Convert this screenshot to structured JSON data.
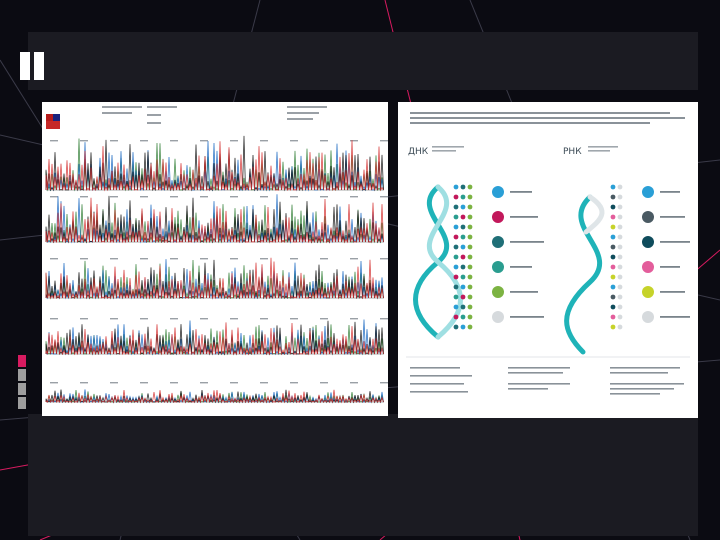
{
  "slide": {
    "dna_heading": "ДНК",
    "rna_heading": "РНК"
  },
  "colors": {
    "slide_background": "#0b0b12",
    "band": "#1b1b22",
    "accent_line": "#d81b60",
    "trace_a": "#2e7d32",
    "trace_c": "#1565c0",
    "trace_g": "#111111",
    "trace_t": "#d32f2f",
    "helix": "#1fb3b8",
    "helix_grey": "#cfd6da"
  },
  "chromatogram": {
    "row_count": 5,
    "description_icon": "sequencing-chromatogram"
  },
  "infographic": {
    "dna_legend_count": 6,
    "rna_legend_count": 6,
    "legend_colors_dna": [
      "#2a9fd6",
      "#c2185b",
      "#1f6f77",
      "#2a9d8f",
      "#7cb342",
      "#d6dadd"
    ],
    "legend_colors_rna": [
      "#2a9fd6",
      "#4a5a63",
      "#0f4c5c",
      "#e35d9b",
      "#c6d32a",
      "#d6dadd"
    ]
  }
}
